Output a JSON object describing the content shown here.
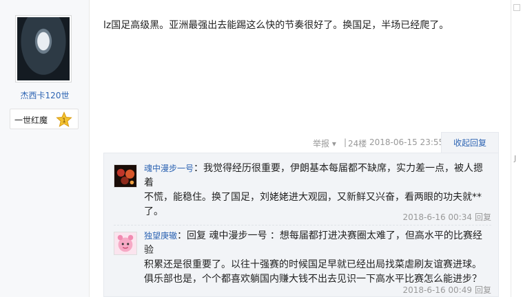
{
  "user": {
    "name": "杰西卡120世",
    "badge_label": "一世红魔",
    "badge_level": "1"
  },
  "post": {
    "text": "lz国足高级黑。亚洲最强出去能踢这么快的节奏很好了。换国足，半场已经爬了。",
    "report_label": "举报",
    "report_arrow": "▾",
    "separator": "|",
    "floor": "24楼",
    "time": "2018-06-15 23:55",
    "collapse_reply_label": "收起回复"
  },
  "comments": [
    {
      "name": "魂中漫步一号",
      "line1": "：我觉得经历很重要，伊朗基本每届都不缺席，实力差一点，被人摁着",
      "line2": "不慌，能稳住。换了国足，刘姥姥进大观园，又新鲜又兴奋，看两眼的功夫就**",
      "line3": "了。",
      "time": "2018-6-16 00:34",
      "reply_label": "回复"
    },
    {
      "name": "独望庚辙",
      "line1": "：回复 魂中漫步一号 ：想每届都打进决赛圈太难了，但高水平的比赛经验",
      "line2": "积累还是很重要了。以往十强赛的时候国足早就已经出局找菜虐刷友谊赛进球。",
      "line3": "俱乐部也是，个个都喜欢躺国内赚大钱不出去见识一下高水平比赛怎么能进步？",
      "time": "2018-6-16 00:49",
      "reply_label": "回复"
    }
  ],
  "side_mark": "J"
}
